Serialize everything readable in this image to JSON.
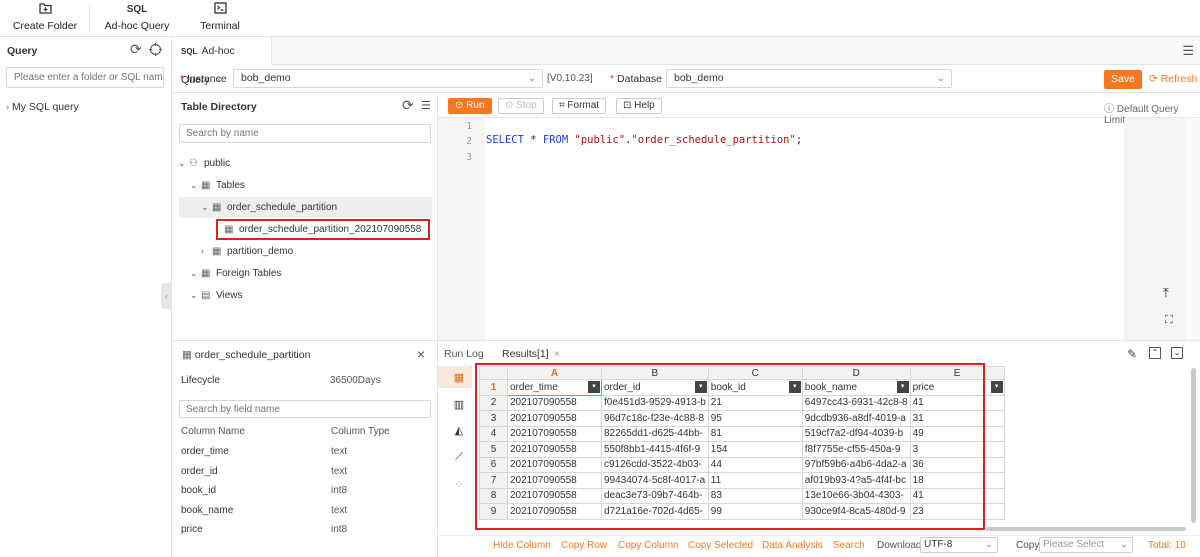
{
  "toolbar": {
    "create_folder": "Create Folder",
    "adhoc_query_icon": "SQL",
    "adhoc_query": "Ad-hoc Query",
    "terminal": "Terminal"
  },
  "left_panel": {
    "title": "Query",
    "search_placeholder": "Please enter a folder or SQL name",
    "item": "My SQL query"
  },
  "tab": {
    "icon": "SQL",
    "label": "Ad-hoc Query"
  },
  "instance": {
    "label": "Instance",
    "value": "bob_demo",
    "version": "[V0.10.23]",
    "db_label": "Database",
    "db_value": "bob_demo",
    "save": "Save",
    "refresh": "Refresh"
  },
  "directory": {
    "title": "Table Directory",
    "search_placeholder": "Search by name",
    "schema": "public",
    "tables": "Tables",
    "table1": "order_schedule_partition",
    "partition1": "order_schedule_partition_202107090558",
    "table2": "partition_demo",
    "foreign": "Foreign Tables",
    "views": "Views"
  },
  "editor": {
    "run": "Run",
    "stop": "Stop",
    "format": "Format",
    "help": "Help",
    "limit": "Default Query Limit",
    "lines": [
      "1",
      "2",
      "3"
    ],
    "sql_kw1": "SELECT",
    "sql_star": " * ",
    "sql_kw2": "FROM",
    "sql_schema": "\"public\"",
    "sql_dot": ".",
    "sql_table": "\"order_schedule_partition\"",
    "sql_end": ";"
  },
  "details": {
    "title": "order_schedule_partition",
    "lifecycle_label": "Lifecycle",
    "lifecycle_value": "36500Days",
    "search_placeholder": "Search by field name",
    "col_name_header": "Column Name",
    "col_type_header": "Column Type",
    "columns": [
      {
        "name": "order_time",
        "type": "text"
      },
      {
        "name": "order_id",
        "type": "text"
      },
      {
        "name": "book_id",
        "type": "int8"
      },
      {
        "name": "book_name",
        "type": "text"
      },
      {
        "name": "price",
        "type": "int8"
      }
    ]
  },
  "results": {
    "run_log": "Run Log",
    "results_tab": "Results[1]",
    "col_letters": [
      "A",
      "B",
      "C",
      "D",
      "E"
    ],
    "fields": [
      "order_time",
      "order_id",
      "book_id",
      "book_name",
      "price"
    ],
    "row_numbers": [
      "1",
      "2",
      "3",
      "4",
      "5",
      "6",
      "7",
      "8",
      "9"
    ],
    "rows": [
      [
        "202107090558",
        "f0e451d3-9529-4913-b",
        "21",
        "6497cc43-6931-42c8-8",
        "41"
      ],
      [
        "202107090558",
        "96d7c18c-f23e-4c88-8",
        "95",
        "9dcdb936-a8df-4019-a",
        "31"
      ],
      [
        "202107090558",
        "82265dd1-d625-44bb-",
        "81",
        "519cf7a2-df94-4039-b",
        "49"
      ],
      [
        "202107090558",
        "550f8bb1-4415-4f6f-9",
        "154",
        "f8f7755e-cf55-450a-9",
        "3"
      ],
      [
        "202107090558",
        "c9126cdd-3522-4b03-",
        "44",
        "97bf59b6-a4b6-4da2-a",
        "36"
      ],
      [
        "202107090558",
        "99434074-5c8f-4017-a",
        "11",
        "af019b93-4?a5-4f4f-bc",
        "18"
      ],
      [
        "202107090558",
        "deac3e73-09b7-464b-",
        "83",
        "13e10e66-3b04-4303-",
        "41"
      ],
      [
        "202107090558",
        "d721a16e-702d-4d65-",
        "99",
        "930ce9f4-8ca5-480d-9",
        "23"
      ]
    ]
  },
  "footer": {
    "hide_column": "Hide Column",
    "copy_row": "Copy Row",
    "copy_column": "Copy Column",
    "copy_selected": "Copy Selected",
    "data_analysis": "Data Analysis",
    "search": "Search",
    "download_label": "Download",
    "encoding": "UTF-8",
    "copy_label": "Copy",
    "copy_placeholder": "Please Select",
    "total": "Total: 10"
  },
  "colors": {
    "accent": "#f5781f",
    "highlight": "#e02020",
    "keyword": "#1f3fd6"
  }
}
